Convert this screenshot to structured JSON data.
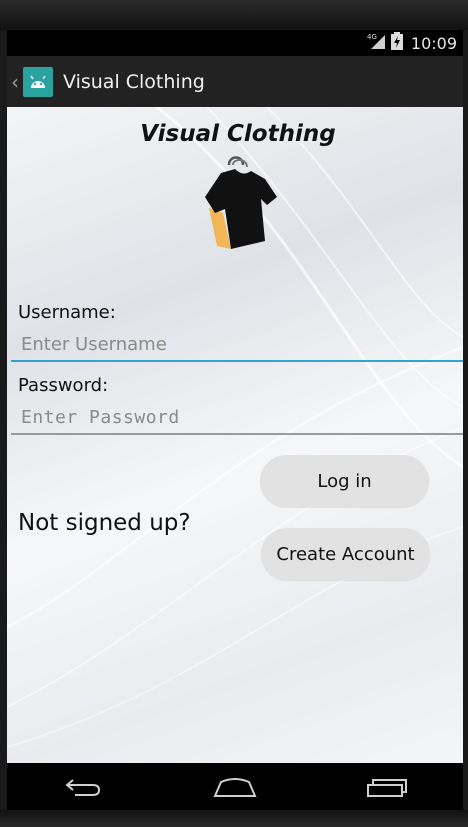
{
  "status_bar": {
    "network": "4G",
    "time": "10:09"
  },
  "action_bar": {
    "title": "Visual Clothing"
  },
  "header": {
    "brand_title": "Visual Clothing"
  },
  "login_form": {
    "username_label": "Username:",
    "username_placeholder": "Enter Username",
    "username_value": "",
    "password_label": "Password:",
    "password_placeholder": "Enter Password",
    "password_value": "",
    "login_button": "Log in"
  },
  "signup": {
    "prompt": "Not signed up?",
    "create_account_button": "Create Account"
  },
  "colors": {
    "accent_focus_line": "#33a3d4",
    "app_icon_bg": "#2aa3a0",
    "button_bg": "#e2e2e2"
  },
  "icons": [
    "back-caret-icon",
    "app-launcher-icon",
    "signal-4g-icon",
    "battery-charging-icon",
    "tshirt-hanger-logo-icon",
    "nav-back-icon",
    "nav-home-icon",
    "nav-recents-icon"
  ]
}
